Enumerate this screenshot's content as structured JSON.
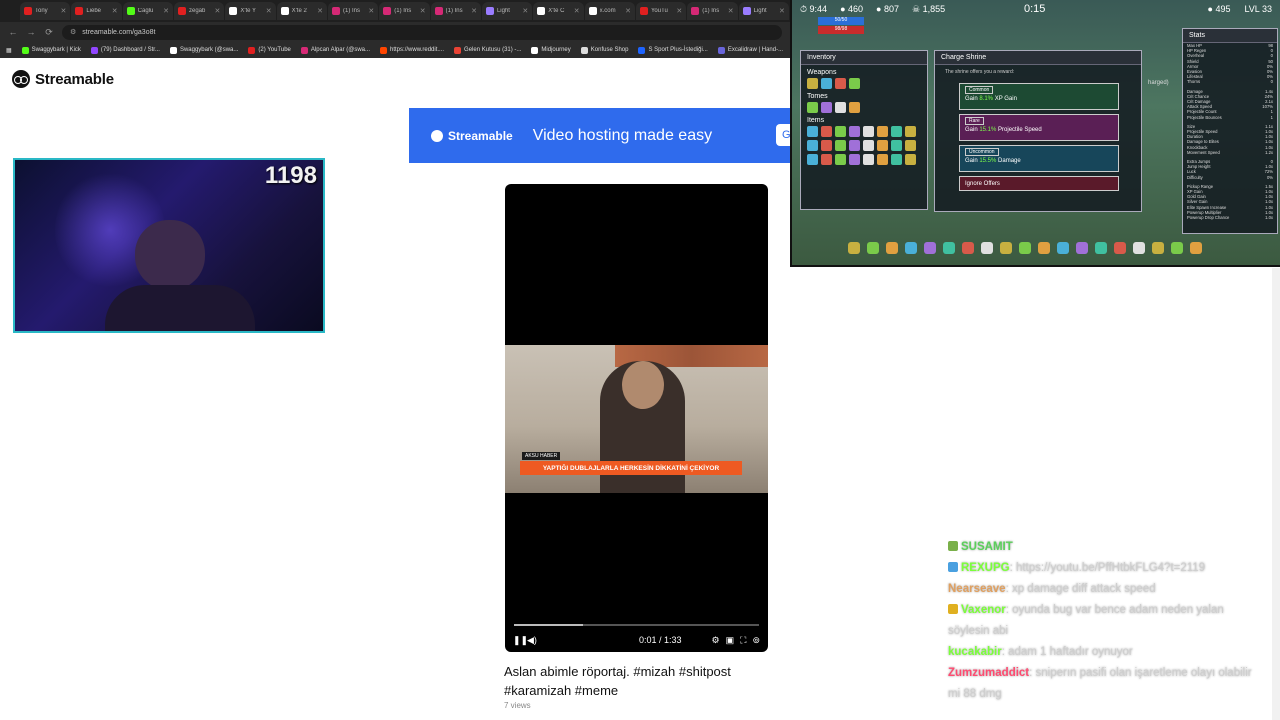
{
  "browser": {
    "tabs": [
      {
        "label": "Tony",
        "color": "#e02020"
      },
      {
        "label": "Liebe",
        "color": "#e02020"
      },
      {
        "label": "Caglu",
        "color": "#53fc18"
      },
      {
        "label": "zegab",
        "color": "#e02020"
      },
      {
        "label": "X'te Y",
        "color": "#ffffff"
      },
      {
        "label": "X'te 2",
        "color": "#ffffff"
      },
      {
        "label": "(1) Ins",
        "color": "#d62976"
      },
      {
        "label": "(1) Ins",
        "color": "#d62976"
      },
      {
        "label": "(1) Ins",
        "color": "#d62976"
      },
      {
        "label": "Light",
        "color": "#9a7cff"
      },
      {
        "label": "X'te C",
        "color": "#ffffff"
      },
      {
        "label": "x.com",
        "color": "#ffffff"
      },
      {
        "label": "YouTu",
        "color": "#e02020"
      },
      {
        "label": "(1) Ins",
        "color": "#d62976"
      },
      {
        "label": "Light",
        "color": "#9a7cff"
      }
    ],
    "url": "streamable.com/ga3o8t",
    "bookmarks": [
      {
        "label": "Swaggybark | Kick",
        "color": "#53fc18"
      },
      {
        "label": "(79) Dashboard / Str...",
        "color": "#9146ff"
      },
      {
        "label": "Swaggybark (@swa...",
        "color": "#ffffff"
      },
      {
        "label": "(2) YouTube",
        "color": "#e02020"
      },
      {
        "label": "Alpcan Alpar (@swa...",
        "color": "#d62976"
      },
      {
        "label": "https://www.reddit....",
        "color": "#ff4500"
      },
      {
        "label": "Gelen Kutusu (31) -...",
        "color": "#ea4335"
      },
      {
        "label": "Midjourney",
        "color": "#ffffff"
      },
      {
        "label": "Konfuse Shop",
        "color": "#dddddd"
      },
      {
        "label": "S Sport Plus-İstediği...",
        "color": "#1e64ff"
      },
      {
        "label": "Excalidraw | Hand-...",
        "color": "#6965db"
      }
    ]
  },
  "site": {
    "logo": "Streamable",
    "ad_logo": "Streamable",
    "ad_tagline": "Video hosting made easy",
    "ad_button": "G"
  },
  "webcam": {
    "counter": "1198"
  },
  "video": {
    "lower_third_tag": "AKSU HABER",
    "lower_third": "YAPTIĞI DUBLAJLARLA HERKESİN DİKKATİNİ ÇEKİYOR",
    "time": "0:01 / 1:33",
    "progress_fraction": 0.011,
    "buffer_fraction": 0.28,
    "title": "Aslan abimle röportaj. #mizah #shitpost #karamizah #meme",
    "views": "7 views"
  },
  "game": {
    "hud": {
      "time": "9:44",
      "kills": "460",
      "gold": "807",
      "souls": "1,855",
      "timer": "0:15",
      "coins": "495",
      "level": "LVL 33",
      "shield": "50/50",
      "hp": "98/98"
    },
    "inventory": {
      "title": "Inventory",
      "weapons_label": "Weapons",
      "tomes_label": "Tomes",
      "items_label": "Items"
    },
    "shrine": {
      "title": "Charge Shrine",
      "subtitle": "The shrine offers you a reward:",
      "offers": [
        {
          "rarity": "Common",
          "prefix": "Gain ",
          "value": "8.1%",
          "stat": " XP Gain"
        },
        {
          "rarity": "Rare",
          "prefix": "Gain ",
          "value": "15.1%",
          "stat": " Projectile Speed"
        },
        {
          "rarity": "Uncommon",
          "prefix": "Gain ",
          "value": "15.5%",
          "stat": " Damage"
        }
      ],
      "ignore": "Ignore Offers",
      "side_hint": "harged)"
    },
    "stats_title": "Stats",
    "stats": [
      [
        "Max HP",
        "98"
      ],
      [
        "HP Regen",
        "0"
      ],
      [
        "Overheal",
        "0"
      ],
      [
        "Shield",
        "50"
      ],
      [
        "Armor",
        "0%"
      ],
      [
        "Evasion",
        "0%"
      ],
      [
        "Lifesteal",
        "0%"
      ],
      [
        "Thorns",
        "0"
      ],
      [
        "Damage",
        "1.4x"
      ],
      [
        "Crit Chance",
        "24%"
      ],
      [
        "Crit Damage",
        "2.1x"
      ],
      [
        "Attack Speed",
        "107%"
      ],
      [
        "Projectile Count",
        "1"
      ],
      [
        "Projectile Bounces",
        "1"
      ],
      [
        "Size",
        "1.1x"
      ],
      [
        "Projectile Speed",
        "1.0x"
      ],
      [
        "Duration",
        "1.0x"
      ],
      [
        "Damage to Elites",
        "1.0x"
      ],
      [
        "Knockback",
        "1.0x"
      ],
      [
        "Movement Speed",
        "1.2x"
      ],
      [
        "Extra Jumps",
        "0"
      ],
      [
        "Jump Height",
        "1.0x"
      ],
      [
        "Luck",
        "72%"
      ],
      [
        "Difficulty",
        "0%"
      ],
      [
        "Pickup Range",
        "1.5x"
      ],
      [
        "XP Gain",
        "1.0x"
      ],
      [
        "Gold Gain",
        "1.0x"
      ],
      [
        "Silver Gain",
        "1.0x"
      ],
      [
        "Elite Spawn Increase",
        "1.0x"
      ],
      [
        "Powerup Multiplier",
        "1.0x"
      ],
      [
        "Powerup Drop Chance",
        "1.0x"
      ]
    ]
  },
  "chat": [
    {
      "user": "SUSAMIT",
      "text": "",
      "color": "#5ad05a",
      "icon": "#7ab04a"
    },
    {
      "user": "REXUPG",
      "text": ": https://youtu.be/PffHtbkFLG4?t=2119",
      "color": "#7bff3a",
      "icon": "#4aa0e0"
    },
    {
      "user": "Nearseave",
      "text": ": xp damage diff attack speed",
      "color": "#e0a060",
      "icon": ""
    },
    {
      "user": "Vaxenor",
      "text": ": oyunda bug var bence adam neden yalan söylesin abi",
      "color": "#7bff3a",
      "icon": "#e0b020"
    },
    {
      "user": "kucakabir",
      "text": ": adam 1 haftadır oynuyor",
      "color": "#7bff3a",
      "icon": ""
    },
    {
      "user": "Zumzumaddict",
      "text": ": sniperın pasifi olan işaretleme olayı olabilir mi 88 dmg",
      "color": "#ff4a70",
      "icon": ""
    }
  ]
}
